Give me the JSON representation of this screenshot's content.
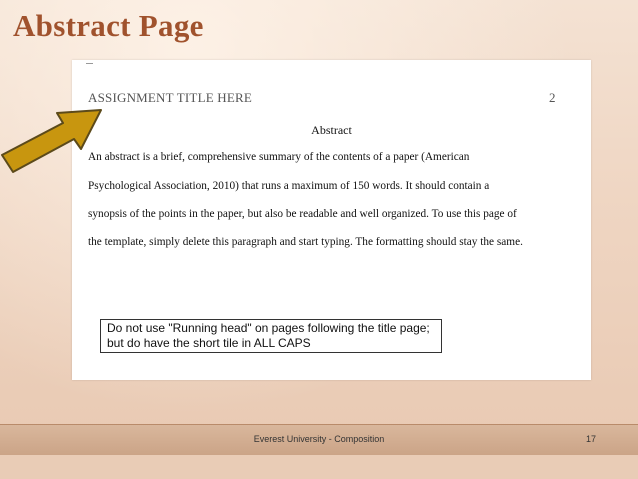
{
  "slide": {
    "title": "Abstract Page"
  },
  "document": {
    "running_head": "ASSIGNMENT TITLE HERE",
    "page_number": "2",
    "heading": "Abstract",
    "lines": [
      "An abstract is a brief, comprehensive summary of the contents of a paper (American",
      "Psychological Association, 2010) that runs a maximum of 150 words.  It should contain a",
      "synopsis of the points in the paper, but also be readable and well organized.  To use this page of",
      "the template, simply delete this paragraph and start typing.  The formatting should stay the same."
    ]
  },
  "callout": {
    "line1": "Do not use \"Running head\" on pages following the title page;",
    "line2": "but do have the short tile in ALL CAPS"
  },
  "arrow": {
    "icon": "arrow-up-right-icon",
    "fill_color": "#c8960f",
    "stroke_color": "#5c4a1a"
  },
  "footer": {
    "center_text": "Everest University - Composition",
    "slide_number": "17"
  },
  "colors": {
    "title": "#a0522d",
    "background": "#f0d8c6"
  }
}
